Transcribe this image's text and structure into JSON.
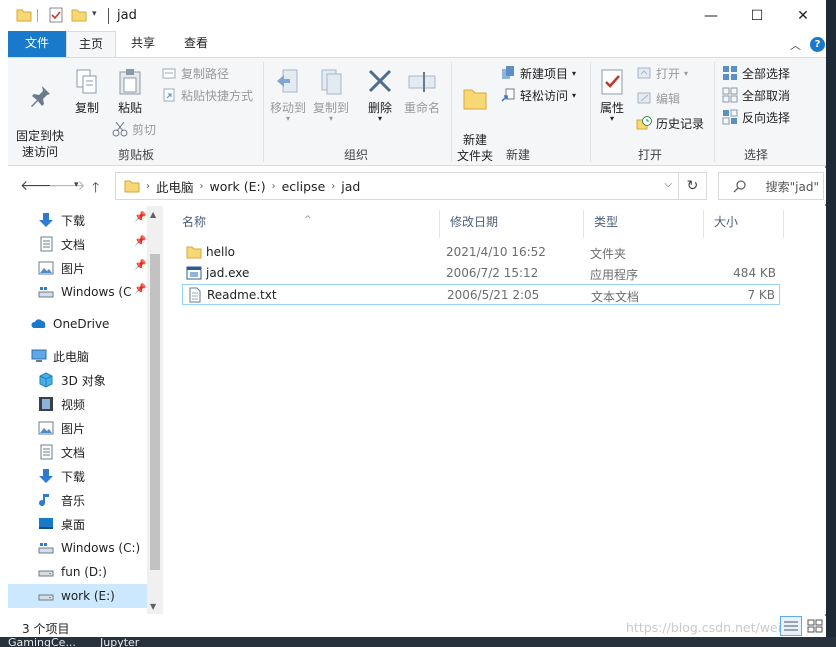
{
  "window": {
    "title": "jad",
    "min_glyph": "—",
    "max_glyph": "☐",
    "close_glyph": "✕"
  },
  "ribbon_tabs": [
    "文件",
    "主页",
    "共享",
    "查看"
  ],
  "ribbon": {
    "clipboard": {
      "label": "剪贴板",
      "pin": "固定到快\n速访问",
      "copy": "复制",
      "paste": "粘贴",
      "copy_path": "复制路径",
      "paste_shortcut": "粘贴快捷方式",
      "cut": "剪切"
    },
    "organize": {
      "label": "组织",
      "move_to": "移动到",
      "copy_to": "复制到",
      "delete": "删除",
      "rename": "重命名"
    },
    "new": {
      "label": "新建",
      "new_folder": "新建\n文件夹",
      "new_item": "新建项目",
      "easy_access": "轻松访问"
    },
    "open": {
      "label": "打开",
      "properties": "属性",
      "open": "打开",
      "edit": "编辑",
      "history": "历史记录"
    },
    "select": {
      "label": "选择",
      "select_all": "全部选择",
      "select_none": "全部取消",
      "invert": "反向选择"
    }
  },
  "address": {
    "crumbs": [
      "此电脑",
      "work (E:)",
      "eclipse",
      "jad"
    ],
    "search_placeholder": "搜索\"jad\""
  },
  "nav_pane": {
    "quick": [
      {
        "label": "下载",
        "icon": "download-icon",
        "pinned": true
      },
      {
        "label": "文档",
        "icon": "document-icon",
        "pinned": true
      },
      {
        "label": "图片",
        "icon": "picture-icon",
        "pinned": true
      },
      {
        "label": "Windows (C",
        "icon": "drive-icon",
        "pinned": true
      }
    ],
    "onedrive": "OneDrive",
    "this_pc": "此电脑",
    "pc_items": [
      {
        "label": "3D 对象",
        "icon": "cube-icon"
      },
      {
        "label": "视频",
        "icon": "video-icon"
      },
      {
        "label": "图片",
        "icon": "picture-icon"
      },
      {
        "label": "文档",
        "icon": "document-icon"
      },
      {
        "label": "下载",
        "icon": "download-icon"
      },
      {
        "label": "音乐",
        "icon": "music-icon"
      },
      {
        "label": "桌面",
        "icon": "desktop-icon"
      },
      {
        "label": "Windows (C:)",
        "icon": "windows-drive-icon"
      },
      {
        "label": "fun (D:)",
        "icon": "drive-icon"
      },
      {
        "label": "work (E:)",
        "icon": "drive-icon",
        "selected": true
      }
    ]
  },
  "columns": [
    "名称",
    "修改日期",
    "类型",
    "大小"
  ],
  "files": [
    {
      "name": "hello",
      "date": "2021/4/10 16:52",
      "type": "文件夹",
      "size": "",
      "icon": "folder-icon"
    },
    {
      "name": "jad.exe",
      "date": "2006/7/2 15:12",
      "type": "应用程序",
      "size": "484 KB",
      "icon": "application-icon"
    },
    {
      "name": "Readme.txt",
      "date": "2006/5/21 2:05",
      "type": "文本文档",
      "size": "7 KB",
      "icon": "text-file-icon"
    }
  ],
  "status": {
    "count": "3 个项目",
    "watermark": "https://blog.csdn.net/weixin"
  },
  "desktop": {
    "labels": [
      "GamingCe...",
      "Jupyter"
    ]
  },
  "colors": {
    "accent": "#1979ca",
    "selection": "#cce8ff",
    "folder": "#f8d775"
  }
}
